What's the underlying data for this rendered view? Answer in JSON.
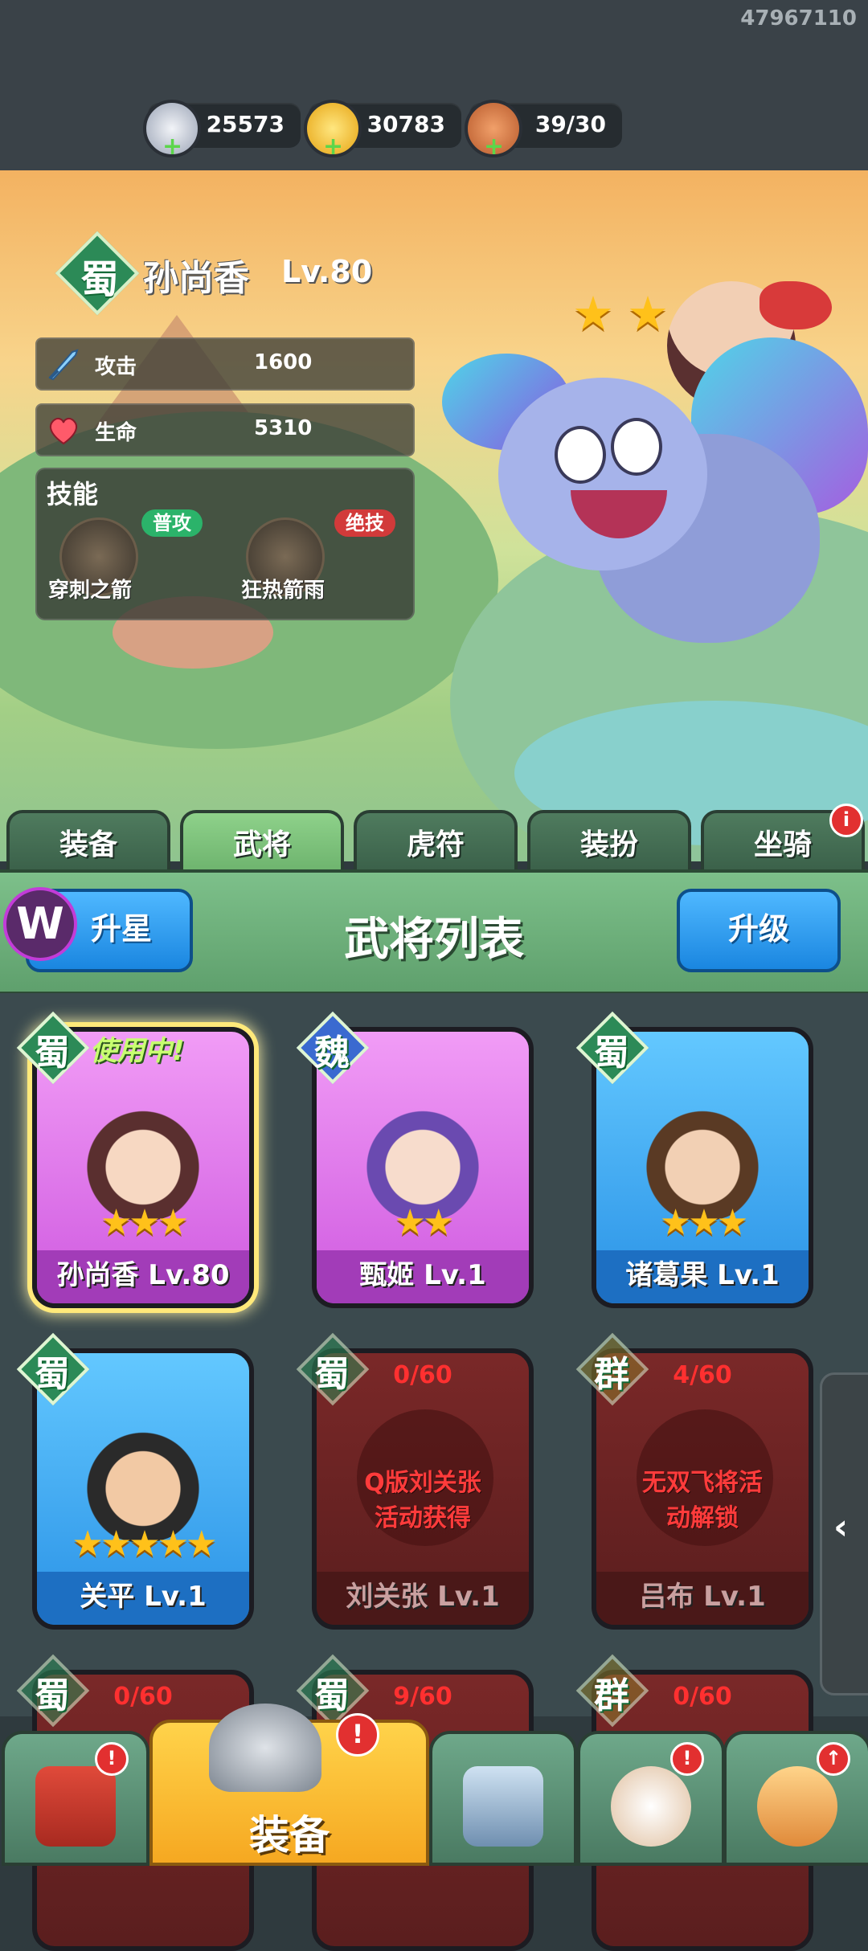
{
  "topbar": {
    "uid": "47967110",
    "resources": [
      {
        "name": "silver-coin-icon",
        "value": "25573"
      },
      {
        "name": "gold-ingot-icon",
        "value": "30783"
      },
      {
        "name": "meat-drumstick-icon",
        "value": "39/30"
      }
    ]
  },
  "hero": {
    "faction": "蜀",
    "name": "孙尚香",
    "level": "Lv.80",
    "stars": 3,
    "stats": [
      {
        "label": "攻击",
        "value": "1600",
        "icon": "sword-icon"
      },
      {
        "label": "生命",
        "value": "5310",
        "icon": "heart-icon"
      }
    ],
    "skills_title": "技能",
    "skills": [
      {
        "name": "穿刺之箭",
        "tag": "普攻",
        "tag_color": "#2bb36a"
      },
      {
        "name": "狂热箭雨",
        "tag": "绝技",
        "tag_color": "#d23a3a"
      }
    ]
  },
  "tabs": [
    {
      "label": "装备",
      "active": false,
      "badge": false
    },
    {
      "label": "武将",
      "active": true,
      "badge": false
    },
    {
      "label": "虎符",
      "active": false,
      "badge": false
    },
    {
      "label": "装扮",
      "active": false,
      "badge": false
    },
    {
      "label": "坐骑",
      "active": false,
      "badge": true
    }
  ],
  "list_header": {
    "title": "武将列表",
    "left_button": "升星",
    "right_button": "升级"
  },
  "generals": [
    {
      "faction": "蜀",
      "name_lv": "孙尚香 Lv.80",
      "style": "purple",
      "stars": 3,
      "in_use": "使用中!",
      "selected": true
    },
    {
      "faction": "魏",
      "name_lv": "甄姬 Lv.1",
      "style": "purple",
      "stars": 2
    },
    {
      "faction": "蜀",
      "name_lv": "诸葛果 Lv.1",
      "style": "blue",
      "stars": 3
    },
    {
      "faction": "蜀",
      "name_lv": "关平 Lv.1",
      "style": "blue",
      "stars": 5
    },
    {
      "faction": "蜀",
      "name_lv": "刘关张 Lv.1",
      "style": "locked",
      "progress": "0/60",
      "lock_line1": "Q版刘关张",
      "lock_line2": "活动获得"
    },
    {
      "faction": "群",
      "name_lv": "吕布 Lv.1",
      "style": "locked",
      "progress": "4/60",
      "lock_line1": "无双飞将活",
      "lock_line2": "动解锁"
    },
    {
      "faction": "蜀",
      "progress": "0/60",
      "style": "locked"
    },
    {
      "faction": "蜀",
      "progress": "9/60",
      "style": "locked"
    },
    {
      "faction": "群",
      "progress": "0/60",
      "style": "locked"
    }
  ],
  "side_handle": "‹",
  "bottom_nav": [
    {
      "icon": "gate-icon",
      "label": "",
      "badge": "!"
    },
    {
      "icon": "helmet-icon",
      "label": "装备",
      "badge": "!"
    },
    {
      "icon": "crossed-swords-shield-icon",
      "label": "",
      "badge": ""
    },
    {
      "icon": "rooster-icon",
      "label": "",
      "badge": "!"
    },
    {
      "icon": "fist-upgrade-icon",
      "label": "",
      "badge": "↑"
    }
  ],
  "colors": {
    "accent_green": "#6db36d",
    "button_blue": "#1a86e0",
    "nav_gold": "#f6a821",
    "star_gold": "#ffc11a",
    "alert_red": "#e23030"
  }
}
